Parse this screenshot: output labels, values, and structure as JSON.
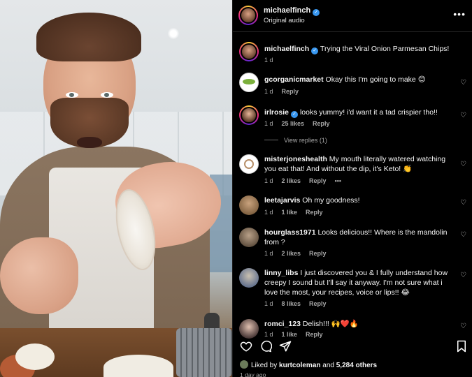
{
  "header": {
    "username": "michaelfinch",
    "subtitle": "Original audio",
    "more_label": "•••"
  },
  "caption": {
    "username": "michaelfinch",
    "text": "Trying the Viral Onion Parmesan Chips!",
    "time": "1 d"
  },
  "comments": [
    {
      "username": "gcorganicmarket",
      "text": "Okay this I'm going to make 😊",
      "time": "1 d",
      "likes": "",
      "reply": "Reply",
      "verified": false
    },
    {
      "username": "irlrosie",
      "text": "looks yummy! i'd want it a tad crispier tho!!",
      "time": "1 d",
      "likes": "25 likes",
      "reply": "Reply",
      "verified": true,
      "view_replies": "View replies (1)"
    },
    {
      "username": "misterjoneshealth",
      "text": "My mouth literally watered watching you eat that! And without the dip, it's Keto! 👏",
      "time": "1 d",
      "likes": "2 likes",
      "reply": "Reply",
      "verified": false,
      "extra": "•••"
    },
    {
      "username": "leetajarvis",
      "text": "Oh my goodness!",
      "time": "1 d",
      "likes": "1 like",
      "reply": "Reply",
      "verified": false
    },
    {
      "username": "hourglass1971",
      "text": "Looks delicious!! Where is the mandolin from ?",
      "time": "1 d",
      "likes": "2 likes",
      "reply": "Reply",
      "verified": false
    },
    {
      "username": "linny_libs",
      "text": "I just discovered you & I fully understand how creepy I sound but I'll say it anyway. I'm not sure what i love the most, your recipes, voice or lips!! 😂",
      "time": "1 d",
      "likes": "8 likes",
      "reply": "Reply",
      "verified": false
    },
    {
      "username": "romci_123",
      "text": "Delish!!! 🙌❤️🔥",
      "time": "1 d",
      "likes": "1 like",
      "reply": "Reply",
      "verified": false
    }
  ],
  "footer": {
    "liked_prefix": "Liked by",
    "liked_user": "kurtcoleman",
    "liked_and": "and",
    "liked_count": "5,284 others",
    "date": "1 day ago"
  },
  "colors": {
    "background": "#000000",
    "verified": "#3897f0",
    "meta": "#a8a8a8"
  }
}
